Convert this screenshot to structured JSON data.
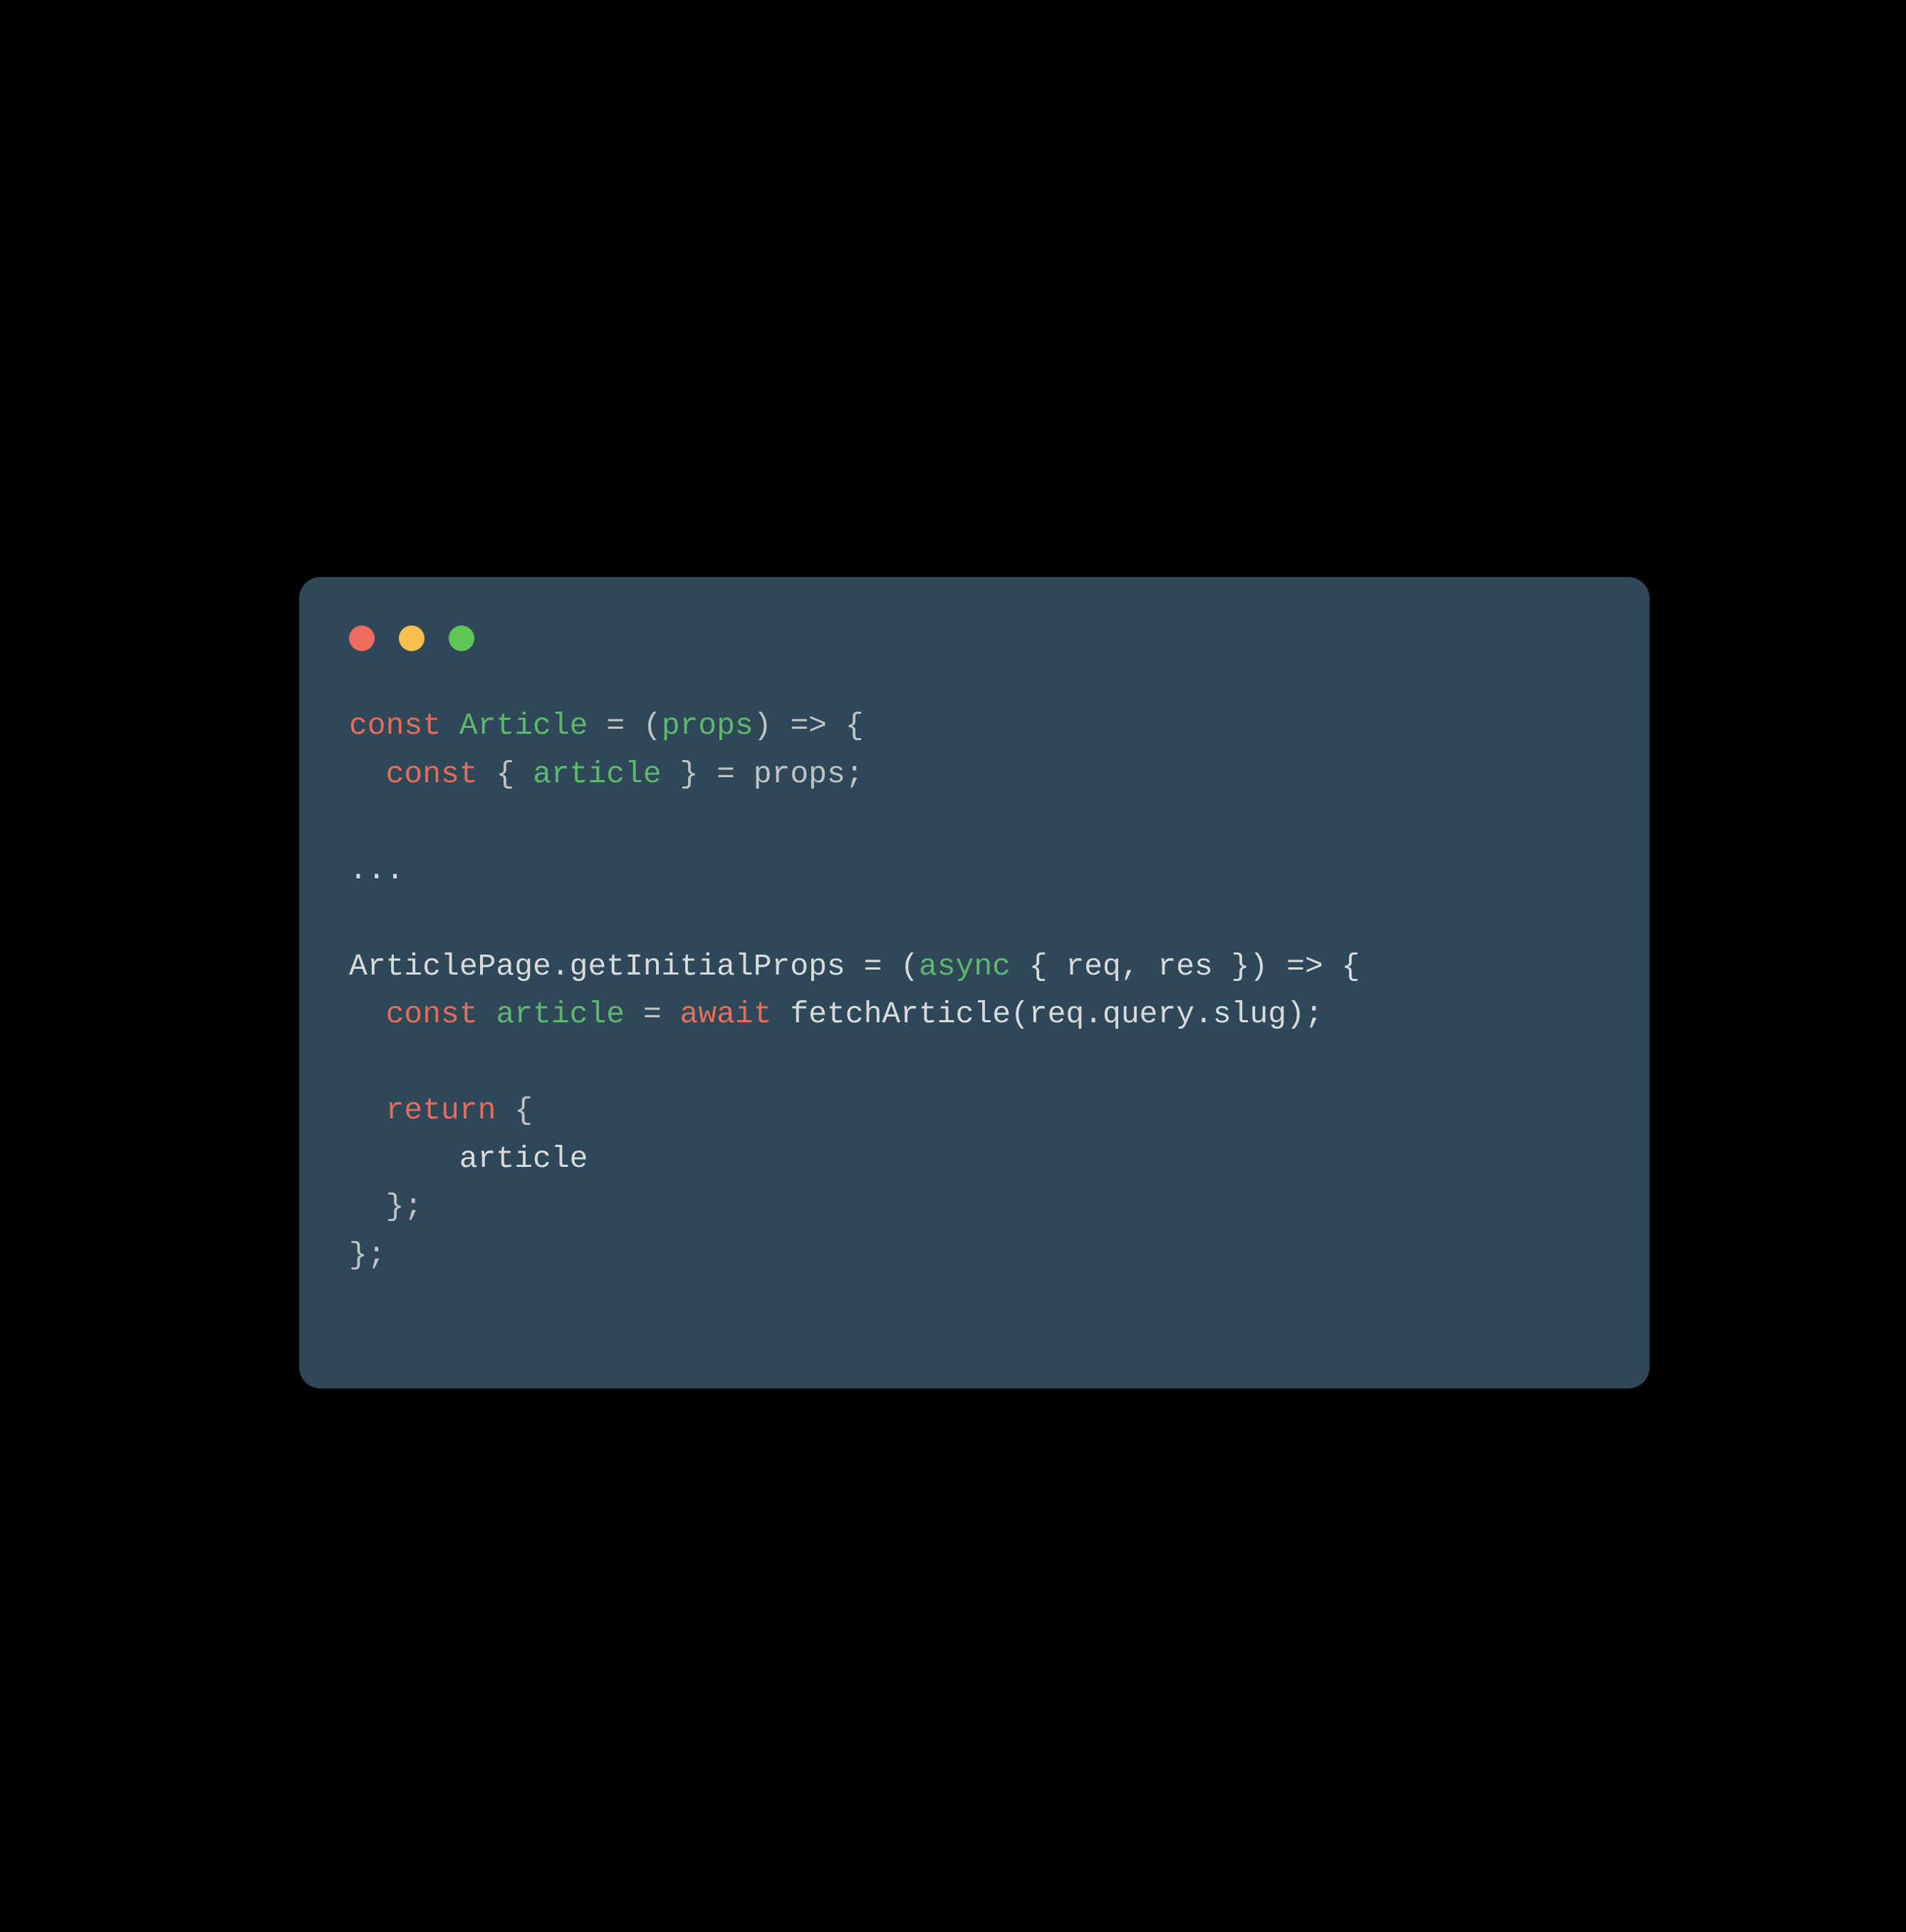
{
  "window": {
    "dots": [
      "close",
      "minimize",
      "zoom"
    ]
  },
  "code": {
    "l1": {
      "const": "const",
      "article": "Article",
      "eq": " = (",
      "props": "props",
      "arrow": ") => {"
    },
    "l2": {
      "indent": "  ",
      "const": "const",
      "open": " { ",
      "article": "article",
      "close": " } = props;"
    },
    "l3": "",
    "l4": "...",
    "l5": "",
    "l6": {
      "lhs": "ArticlePage.getInitialProps = (",
      "async": "async",
      "mid": " { req, res }) => {"
    },
    "l7": {
      "indent": "  ",
      "const": "const",
      "sp": " ",
      "article": "article",
      "eq": " = ",
      "await": "await",
      "call": " fetchArticle(req.query.slug);"
    },
    "l8": "",
    "l9": {
      "indent": "  ",
      "return": "return",
      "open": " {"
    },
    "l10": "      article",
    "l11": "  };",
    "l12": "};"
  }
}
